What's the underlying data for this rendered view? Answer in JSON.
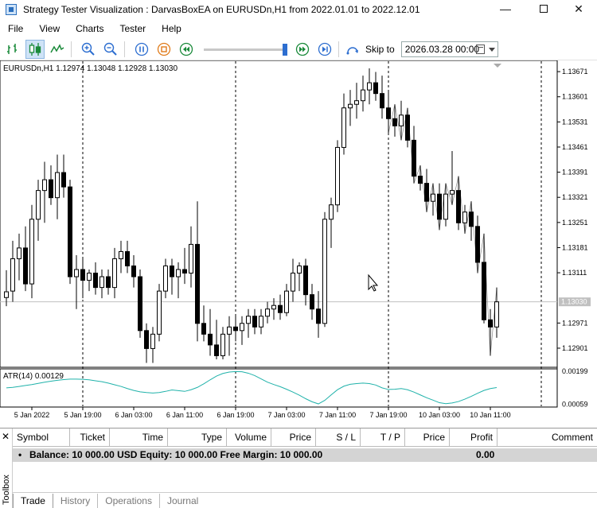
{
  "window": {
    "title": "Strategy Tester Visualization : DarvasBoxEA on EURUSDn,H1 from 2022.01.01 to 2022.12.01"
  },
  "menu": [
    "File",
    "View",
    "Charts",
    "Tester",
    "Help"
  ],
  "toolbar": {
    "skip_label": "Skip to",
    "skip_date": "2026.03.28 00:00",
    "speed": 0.97
  },
  "chart": {
    "header": "EURUSDn,H1  1.12974 1.13048 1.12928 1.13030",
    "current_price": "1.13030",
    "price_ticks": [
      "1.13671",
      "1.13601",
      "1.13531",
      "1.13461",
      "1.13391",
      "1.13321",
      "1.13251",
      "1.13181",
      "1.13111",
      "1.12971",
      "1.12901"
    ],
    "indicator_label": "ATR(14) 0.00129",
    "indicator_ticks": [
      "0.00199",
      "0.00059"
    ],
    "time_labels": [
      "5 Jan 2022",
      "5 Jan 19:00",
      "6 Jan 03:00",
      "6 Jan 11:00",
      "6 Jan 19:00",
      "7 Jan 03:00",
      "7 Jan 11:00",
      "7 Jan 19:00",
      "10 Jan 03:00",
      "10 Jan 11:00"
    ]
  },
  "chart_data": {
    "type": "candlestick",
    "symbol": "EURUSDn,H1",
    "ylim": [
      1.1285,
      1.137
    ],
    "candles": [
      {
        "o": 1.13042,
        "h": 1.13118,
        "l": 1.13018,
        "c": 1.13058
      },
      {
        "o": 1.1306,
        "h": 1.132,
        "l": 1.1303,
        "c": 1.1315
      },
      {
        "o": 1.1315,
        "h": 1.1322,
        "l": 1.1309,
        "c": 1.1318
      },
      {
        "o": 1.1318,
        "h": 1.1324,
        "l": 1.1306,
        "c": 1.1308
      },
      {
        "o": 1.1308,
        "h": 1.133,
        "l": 1.1304,
        "c": 1.1326
      },
      {
        "o": 1.1326,
        "h": 1.1337,
        "l": 1.132,
        "c": 1.1334
      },
      {
        "o": 1.1334,
        "h": 1.1342,
        "l": 1.1325,
        "c": 1.1337
      },
      {
        "o": 1.1337,
        "h": 1.1341,
        "l": 1.133,
        "c": 1.1332
      },
      {
        "o": 1.1332,
        "h": 1.1344,
        "l": 1.1326,
        "c": 1.1339
      },
      {
        "o": 1.1339,
        "h": 1.1344,
        "l": 1.1332,
        "c": 1.1335
      },
      {
        "o": 1.1335,
        "h": 1.1337,
        "l": 1.1308,
        "c": 1.131
      },
      {
        "o": 1.131,
        "h": 1.1316,
        "l": 1.1301,
        "c": 1.1312
      },
      {
        "o": 1.1312,
        "h": 1.1315,
        "l": 1.1304,
        "c": 1.1309
      },
      {
        "o": 1.1309,
        "h": 1.1312,
        "l": 1.1306,
        "c": 1.1311
      },
      {
        "o": 1.1311,
        "h": 1.1314,
        "l": 1.1305,
        "c": 1.1307
      },
      {
        "o": 1.1307,
        "h": 1.1312,
        "l": 1.1304,
        "c": 1.131
      },
      {
        "o": 1.131,
        "h": 1.1312,
        "l": 1.1305,
        "c": 1.1307
      },
      {
        "o": 1.1307,
        "h": 1.1318,
        "l": 1.1304,
        "c": 1.1315
      },
      {
        "o": 1.1315,
        "h": 1.132,
        "l": 1.1311,
        "c": 1.1317
      },
      {
        "o": 1.1317,
        "h": 1.132,
        "l": 1.1311,
        "c": 1.1313
      },
      {
        "o": 1.1313,
        "h": 1.1316,
        "l": 1.1307,
        "c": 1.131
      },
      {
        "o": 1.131,
        "h": 1.1312,
        "l": 1.1293,
        "c": 1.1295
      },
      {
        "o": 1.1295,
        "h": 1.1297,
        "l": 1.1286,
        "c": 1.129
      },
      {
        "o": 1.129,
        "h": 1.1296,
        "l": 1.1286,
        "c": 1.1294
      },
      {
        "o": 1.1294,
        "h": 1.1308,
        "l": 1.1292,
        "c": 1.1306
      },
      {
        "o": 1.1306,
        "h": 1.1315,
        "l": 1.1304,
        "c": 1.1313
      },
      {
        "o": 1.1313,
        "h": 1.1315,
        "l": 1.1305,
        "c": 1.131
      },
      {
        "o": 1.131,
        "h": 1.1314,
        "l": 1.1304,
        "c": 1.1312
      },
      {
        "o": 1.1312,
        "h": 1.1318,
        "l": 1.1308,
        "c": 1.1311
      },
      {
        "o": 1.1311,
        "h": 1.1324,
        "l": 1.1307,
        "c": 1.1319
      },
      {
        "o": 1.1319,
        "h": 1.1331,
        "l": 1.1292,
        "c": 1.1297
      },
      {
        "o": 1.1297,
        "h": 1.1302,
        "l": 1.1292,
        "c": 1.1294
      },
      {
        "o": 1.1294,
        "h": 1.1301,
        "l": 1.1288,
        "c": 1.1291
      },
      {
        "o": 1.1291,
        "h": 1.1298,
        "l": 1.1287,
        "c": 1.1288
      },
      {
        "o": 1.1288,
        "h": 1.1296,
        "l": 1.1287,
        "c": 1.1294
      },
      {
        "o": 1.1294,
        "h": 1.1299,
        "l": 1.1288,
        "c": 1.1296
      },
      {
        "o": 1.1296,
        "h": 1.1299,
        "l": 1.1292,
        "c": 1.1295
      },
      {
        "o": 1.1295,
        "h": 1.1299,
        "l": 1.1291,
        "c": 1.1297
      },
      {
        "o": 1.1297,
        "h": 1.1301,
        "l": 1.1293,
        "c": 1.1299
      },
      {
        "o": 1.1299,
        "h": 1.1301,
        "l": 1.1294,
        "c": 1.1296
      },
      {
        "o": 1.1296,
        "h": 1.1301,
        "l": 1.1294,
        "c": 1.1299
      },
      {
        "o": 1.1299,
        "h": 1.1303,
        "l": 1.1297,
        "c": 1.1301
      },
      {
        "o": 1.1301,
        "h": 1.1304,
        "l": 1.1298,
        "c": 1.1302
      },
      {
        "o": 1.1302,
        "h": 1.1305,
        "l": 1.1298,
        "c": 1.13
      },
      {
        "o": 1.13,
        "h": 1.1308,
        "l": 1.1299,
        "c": 1.1306
      },
      {
        "o": 1.1306,
        "h": 1.1315,
        "l": 1.1303,
        "c": 1.1311
      },
      {
        "o": 1.1311,
        "h": 1.1314,
        "l": 1.1306,
        "c": 1.1313
      },
      {
        "o": 1.1313,
        "h": 1.1315,
        "l": 1.1302,
        "c": 1.1305
      },
      {
        "o": 1.1305,
        "h": 1.1308,
        "l": 1.1298,
        "c": 1.1301
      },
      {
        "o": 1.1301,
        "h": 1.1306,
        "l": 1.1293,
        "c": 1.1297
      },
      {
        "o": 1.1297,
        "h": 1.1328,
        "l": 1.1296,
        "c": 1.1326
      },
      {
        "o": 1.1326,
        "h": 1.1332,
        "l": 1.1318,
        "c": 1.133
      },
      {
        "o": 1.133,
        "h": 1.1348,
        "l": 1.1328,
        "c": 1.1346
      },
      {
        "o": 1.1346,
        "h": 1.1361,
        "l": 1.1344,
        "c": 1.1357
      },
      {
        "o": 1.1357,
        "h": 1.1362,
        "l": 1.1352,
        "c": 1.1358
      },
      {
        "o": 1.1358,
        "h": 1.1364,
        "l": 1.1354,
        "c": 1.1359
      },
      {
        "o": 1.1359,
        "h": 1.1366,
        "l": 1.1356,
        "c": 1.1362
      },
      {
        "o": 1.1362,
        "h": 1.1368,
        "l": 1.1358,
        "c": 1.1364
      },
      {
        "o": 1.1364,
        "h": 1.1367,
        "l": 1.1359,
        "c": 1.1361
      },
      {
        "o": 1.1361,
        "h": 1.1366,
        "l": 1.1354,
        "c": 1.1357
      },
      {
        "o": 1.1357,
        "h": 1.1362,
        "l": 1.135,
        "c": 1.1354
      },
      {
        "o": 1.1354,
        "h": 1.1358,
        "l": 1.1349,
        "c": 1.1352
      },
      {
        "o": 1.1352,
        "h": 1.1359,
        "l": 1.1348,
        "c": 1.1355
      },
      {
        "o": 1.1355,
        "h": 1.1357,
        "l": 1.1346,
        "c": 1.1348
      },
      {
        "o": 1.1348,
        "h": 1.1352,
        "l": 1.1336,
        "c": 1.1338
      },
      {
        "o": 1.1338,
        "h": 1.1341,
        "l": 1.1334,
        "c": 1.1336
      },
      {
        "o": 1.1336,
        "h": 1.134,
        "l": 1.1328,
        "c": 1.1331
      },
      {
        "o": 1.1331,
        "h": 1.1336,
        "l": 1.1327,
        "c": 1.1333
      },
      {
        "o": 1.1333,
        "h": 1.1336,
        "l": 1.1323,
        "c": 1.1326
      },
      {
        "o": 1.1326,
        "h": 1.1336,
        "l": 1.1324,
        "c": 1.1333
      },
      {
        "o": 1.1333,
        "h": 1.1345,
        "l": 1.133,
        "c": 1.1334
      },
      {
        "o": 1.1334,
        "h": 1.1338,
        "l": 1.1323,
        "c": 1.1325
      },
      {
        "o": 1.1325,
        "h": 1.133,
        "l": 1.1322,
        "c": 1.1328
      },
      {
        "o": 1.1328,
        "h": 1.1331,
        "l": 1.132,
        "c": 1.1324
      },
      {
        "o": 1.1324,
        "h": 1.1327,
        "l": 1.1311,
        "c": 1.1314
      },
      {
        "o": 1.1314,
        "h": 1.1322,
        "l": 1.1297,
        "c": 1.1298
      },
      {
        "o": 1.1298,
        "h": 1.1301,
        "l": 1.1288,
        "c": 1.1296
      },
      {
        "o": 1.1296,
        "h": 1.1307,
        "l": 1.1293,
        "c": 1.1303
      }
    ],
    "atr": [
      0.00128,
      0.0013,
      0.00134,
      0.00138,
      0.00142,
      0.00147,
      0.00152,
      0.00156,
      0.0016,
      0.00163,
      0.00165,
      0.00165,
      0.00164,
      0.00162,
      0.00158,
      0.00154,
      0.00148,
      0.00141,
      0.00134,
      0.00125,
      0.00117,
      0.00111,
      0.00108,
      0.00106,
      0.00108,
      0.00113,
      0.00119,
      0.00116,
      0.00113,
      0.0012,
      0.0013,
      0.00145,
      0.00162,
      0.00178,
      0.00189,
      0.00195,
      0.00197,
      0.00196,
      0.0019,
      0.0018,
      0.00166,
      0.00152,
      0.00142,
      0.00133,
      0.00122,
      0.0011,
      0.00097,
      0.00082,
      0.00069,
      0.0006,
      0.00075,
      0.00098,
      0.0012,
      0.00135,
      0.00143,
      0.00146,
      0.00148,
      0.00146,
      0.0014,
      0.00128,
      0.00121,
      0.00122,
      0.00125,
      0.0012,
      0.0011,
      0.00098,
      0.00086,
      0.00076,
      0.00065,
      0.00061,
      0.00064,
      0.0007,
      0.0008,
      0.00092,
      0.00105,
      0.00117,
      0.00125,
      0.00129
    ],
    "atr_ylim": [
      0.0005,
      0.00205
    ],
    "vlines_at_candle": [
      13,
      37,
      62,
      87
    ]
  },
  "toolbox": {
    "columns": [
      "Symbol",
      "Ticket",
      "Time",
      "Type",
      "Volume",
      "Price",
      "S / L",
      "T / P",
      "Price",
      "Profit",
      "Comment"
    ],
    "balance": "Balance: 10 000.00 USD  Equity: 10 000.00  Free Margin: 10 000.00",
    "profit": "0.00",
    "tabs": [
      "Trade",
      "History",
      "Operations",
      "Journal"
    ],
    "label": "Toolbox"
  },
  "colors": {
    "bear": "#000000",
    "bull": "#ffffff",
    "atr_line": "#20b2aa",
    "grid_dash": "#000000"
  }
}
